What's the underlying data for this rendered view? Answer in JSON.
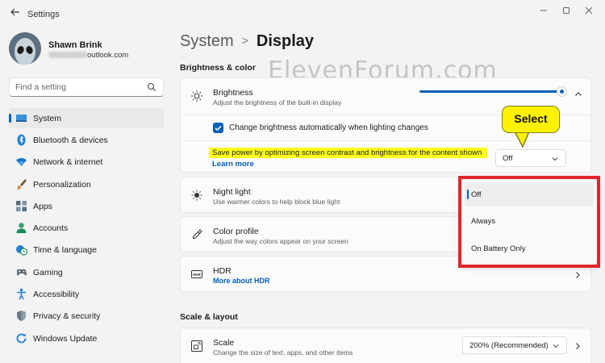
{
  "window": {
    "title": "Settings"
  },
  "user": {
    "name": "Shawn Brink",
    "email_suffix": "outlook.com"
  },
  "search": {
    "placeholder": "Find a setting"
  },
  "sidebar": {
    "items": [
      {
        "label": "System",
        "icon": "monitor-icon",
        "active": true
      },
      {
        "label": "Bluetooth & devices",
        "icon": "bluetooth-icon"
      },
      {
        "label": "Network & internet",
        "icon": "wifi-icon"
      },
      {
        "label": "Personalization",
        "icon": "brush-icon"
      },
      {
        "label": "Apps",
        "icon": "apps-icon"
      },
      {
        "label": "Accounts",
        "icon": "person-icon"
      },
      {
        "label": "Time & language",
        "icon": "clock-globe-icon"
      },
      {
        "label": "Gaming",
        "icon": "gamepad-icon"
      },
      {
        "label": "Accessibility",
        "icon": "accessibility-icon"
      },
      {
        "label": "Privacy & security",
        "icon": "shield-icon"
      },
      {
        "label": "Windows Update",
        "icon": "update-icon"
      }
    ]
  },
  "breadcrumb": {
    "parent": "System",
    "current": "Display"
  },
  "watermark": "ElevenForum.com",
  "sections": {
    "brightness_color": "Brightness & color",
    "scale_layout": "Scale & layout"
  },
  "brightness": {
    "title": "Brightness",
    "subtitle": "Adjust the brightness of the built-in display",
    "level": 1.0,
    "auto_label": "Change brightness automatically when lighting changes",
    "auto_checked": true,
    "save_power_label": "Save power by optimizing screen contrast and brightness for the content shown",
    "learn_more": "Learn more",
    "save_power_value": "Off"
  },
  "callout": "Select",
  "dropdown_options": [
    {
      "label": "Off",
      "selected": true
    },
    {
      "label": "Always",
      "selected": false
    },
    {
      "label": "On Battery Only",
      "selected": false
    }
  ],
  "night_light": {
    "title": "Night light",
    "subtitle": "Use warmer colors to help block blue light"
  },
  "color_profile": {
    "title": "Color profile",
    "subtitle": "Adjust the way colors appear on your screen"
  },
  "hdr": {
    "title": "HDR",
    "link": "More about HDR"
  },
  "scale": {
    "title": "Scale",
    "subtitle": "Change the size of text, apps, and other items",
    "value": "200% (Recommended)"
  },
  "colors": {
    "accent": "#005fb8",
    "highlight": "#ffff1a",
    "red_box": "#e3262c"
  }
}
